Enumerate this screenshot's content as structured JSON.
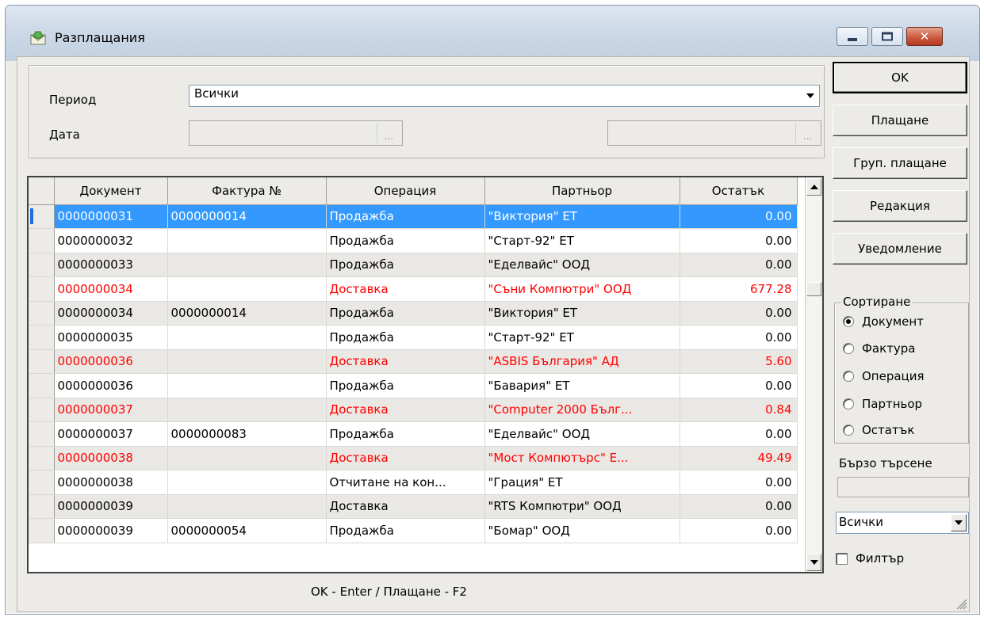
{
  "window": {
    "title": "Разплащания",
    "minimize_icon": "minimize-icon",
    "maximize_icon": "maximize-icon",
    "close_icon": "close-icon"
  },
  "filters": {
    "period_label": "Период",
    "period_value": "Всички",
    "date_label": "Дата",
    "date_from": "",
    "date_to": "",
    "ellipsis": "..."
  },
  "grid": {
    "columns": [
      "Документ",
      "Фактура №",
      "Операция",
      "Партньор",
      "Остатък"
    ],
    "rows": [
      {
        "doc": "0000000031",
        "invoice": "0000000014",
        "operation": "Продажба",
        "partner": "\"Виктория\" ЕТ",
        "balance": "0.00"
      },
      {
        "doc": "0000000032",
        "invoice": "",
        "operation": "Продажба",
        "partner": "\"Старт-92\" ЕТ",
        "balance": "0.00"
      },
      {
        "doc": "0000000033",
        "invoice": "",
        "operation": "Продажба",
        "partner": "\"Еделвайс\" ООД",
        "balance": "0.00"
      },
      {
        "doc": "0000000034",
        "invoice": "",
        "operation": "Доставка",
        "partner": "\"Съни Компютри\" ООД",
        "balance": "677.28"
      },
      {
        "doc": "0000000034",
        "invoice": "0000000014",
        "operation": "Продажба",
        "partner": "\"Виктория\" ЕТ",
        "balance": "0.00"
      },
      {
        "doc": "0000000035",
        "invoice": "",
        "operation": "Продажба",
        "partner": "\"Старт-92\" ЕТ",
        "balance": "0.00"
      },
      {
        "doc": "0000000036",
        "invoice": "",
        "operation": "Доставка",
        "partner": "\"ASBIS България\" АД",
        "balance": "5.60"
      },
      {
        "doc": "0000000036",
        "invoice": "",
        "operation": "Продажба",
        "partner": "\"Бавария\" ЕТ",
        "balance": "0.00"
      },
      {
        "doc": "0000000037",
        "invoice": "",
        "operation": "Доставка",
        "partner": "\"Computer 2000  Бълг...",
        "balance": "0.84"
      },
      {
        "doc": "0000000037",
        "invoice": "0000000083",
        "operation": "Продажба",
        "partner": "\"Еделвайс\" ООД",
        "balance": "0.00"
      },
      {
        "doc": "0000000038",
        "invoice": "",
        "operation": "Доставка",
        "partner": "\"Мост Компютърс\" Е...",
        "balance": "49.49"
      },
      {
        "doc": "0000000038",
        "invoice": "",
        "operation": "Отчитане на кон...",
        "partner": "\"Грация\" ЕТ",
        "balance": "0.00"
      },
      {
        "doc": "0000000039",
        "invoice": "",
        "operation": "Доставка",
        "partner": "\"RTS Компютри\" ООД",
        "balance": "0.00"
      },
      {
        "doc": "0000000039",
        "invoice": "0000000054",
        "operation": "Продажба",
        "partner": "\"Бомар\" ООД",
        "balance": "0.00"
      }
    ]
  },
  "status": "OK - Enter / Плащане - F2",
  "buttons": {
    "ok": "OK",
    "pay": "Плащане",
    "group_pay": "Груп. плащане",
    "edit": "Редакция",
    "notify": "Уведомление"
  },
  "sort": {
    "legend": "Сортиране",
    "options": [
      "Документ",
      "Фактура",
      "Операция",
      "Партньор",
      "Остатък"
    ],
    "selected": "Документ"
  },
  "quick_search": {
    "label": "Бързо търсене",
    "value": ""
  },
  "scope": {
    "value": "Всички"
  },
  "filter_checkbox": {
    "label": "Филтър",
    "checked": false
  },
  "colors": {
    "selection": "#3399ff",
    "delivery_text": "#ff0000",
    "alt_row": "#eae8e4"
  }
}
